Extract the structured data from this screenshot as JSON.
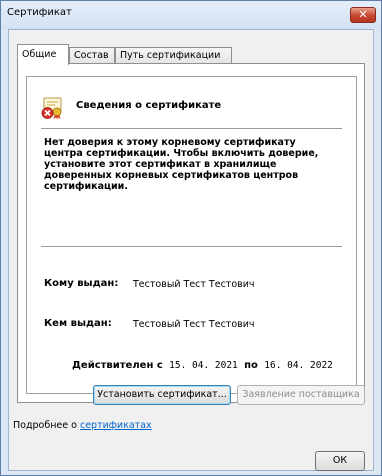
{
  "window": {
    "title": "Сертификат",
    "close_glyph": "✕"
  },
  "tabs": [
    {
      "label": "Общие"
    },
    {
      "label": "Состав"
    },
    {
      "label": "Путь сертификации"
    }
  ],
  "general": {
    "icon": "certificate-error-icon",
    "heading": "Сведения о сертификате",
    "warning": "Нет доверия к этому корневому сертификату центра сертификации. Чтобы включить доверие, установите этот сертификат в хранилище доверенных корневых сертификатов центров сертификации.",
    "issued_to_label": "Кому выдан:",
    "issued_to_value": "Тестовый Тест Тестович",
    "issued_by_label": "Кем выдан:",
    "issued_by_value": "Тестовый Тест Тестович",
    "valid_label": "Действителен с",
    "valid_from": "15. 04. 2021",
    "valid_to_label": "по",
    "valid_to": "16. 04. 2022"
  },
  "buttons": {
    "install": "Установить сертификат...",
    "issuer_statement": "Заявление поставщика",
    "ok": "ОК"
  },
  "footer": {
    "more_prefix": "Подробнее о ",
    "more_link": "сертификатах"
  },
  "colors": {
    "link": "#0066cc",
    "close_button": "#c6452f",
    "disabled_text": "#8d8d8d"
  }
}
